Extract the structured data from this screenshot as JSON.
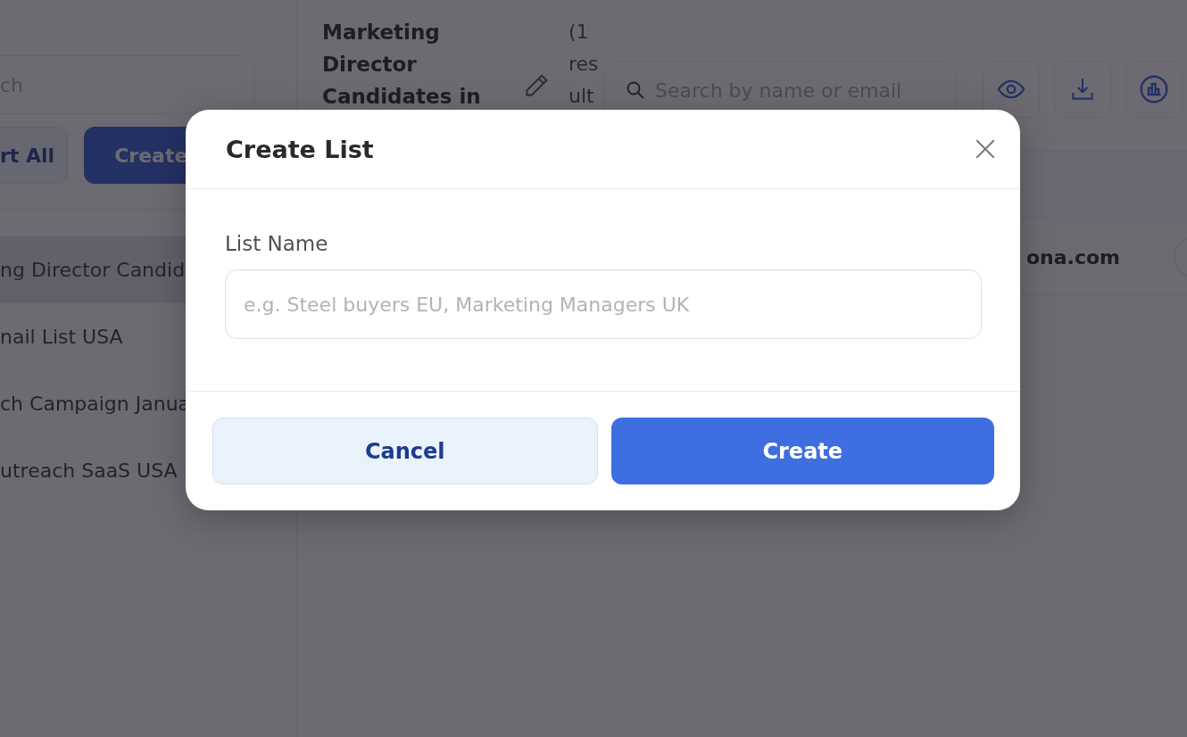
{
  "sidebar": {
    "search": {
      "placeholder": "ch"
    },
    "buttons": [
      {
        "label": "rt All",
        "kind": "secondary"
      },
      {
        "label": "Create",
        "kind": "primary"
      }
    ],
    "lists": [
      {
        "label": "ng Director Candid",
        "selected": true
      },
      {
        "label": "nail List USA",
        "selected": false
      },
      {
        "label": "ch Campaign Janua",
        "selected": false
      },
      {
        "label": "utreach SaaS USA",
        "selected": false
      }
    ]
  },
  "header": {
    "title_lines": [
      "Marketing",
      "Director",
      "Candidates in"
    ],
    "count_lines": [
      "(1",
      "res",
      "ult"
    ],
    "search": {
      "placeholder": "Search by name or email"
    }
  },
  "table": {
    "rows": [
      {
        "column_1": "ona.com"
      }
    ]
  },
  "dialog": {
    "title": "Create List",
    "field": {
      "label": "List Name",
      "placeholder": "e.g. Steel buyers EU, Marketing Managers UK"
    },
    "buttons": [
      {
        "label": "Cancel",
        "kind": "secondary"
      },
      {
        "label": "Create",
        "kind": "primary"
      }
    ]
  }
}
